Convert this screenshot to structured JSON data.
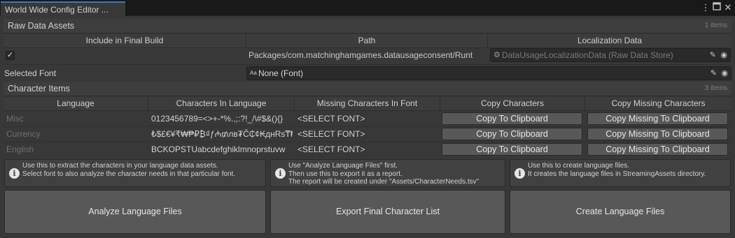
{
  "window": {
    "tab_title": "World Wide Config Editor ...",
    "menu_icon": "kebab-menu-icon",
    "maximize_icon": "maximize-icon",
    "close_icon": "close-icon"
  },
  "raw_data_assets": {
    "title": "Raw Data Assets",
    "count": "1 items",
    "columns": [
      "Include in Final Build",
      "Path",
      "Localization Data"
    ],
    "rows": [
      {
        "include": true,
        "path": "Packages/com.matchinghamgames.datausageconsent/Runt",
        "localization_data": "DataUsageLocalizationData (Raw Data Store)"
      }
    ]
  },
  "selected_font": {
    "label": "Selected Font",
    "value": "None (Font)",
    "prefix_icon": "Aa"
  },
  "character_items": {
    "title": "Character Items",
    "count": "3 items",
    "columns": [
      "Language",
      "Characters In Language",
      "Missing Characters In Font",
      "Copy  Characters",
      "Copy  Missing  Characters"
    ],
    "rows": [
      {
        "language": "Misc",
        "characters": "0123456789=<>+-*%.,;:?!_/\\#$&(){}",
        "missing": "<SELECT FONT>",
        "copy_label": "Copy To Clipboard",
        "copy_missing_label": "Copy Missing To Clipboard"
      },
      {
        "language": "Currency",
        "characters": "₺$£€¥₹₩₱₽₿₫ƒ₼₥лв₮Č₵¢₭днRs₸₦",
        "missing": "<SELECT FONT>",
        "copy_label": "Copy To Clipboard",
        "copy_missing_label": "Copy Missing To Clipboard"
      },
      {
        "language": "English",
        "characters": "BCKOPSTUabcdefghiklmnoprstuvw",
        "missing": "<SELECT FONT>",
        "copy_label": "Copy To Clipboard",
        "copy_missing_label": "Copy Missing To Clipboard"
      }
    ]
  },
  "help_boxes": [
    {
      "lines": [
        "Use this to extract the characters in your language data assets.",
        "Select font to also analyze the character needs in that particular font."
      ]
    },
    {
      "lines": [
        "Use \"Analyze Language Files\" first.",
        "Then use this to export it as a report.",
        "The report will be created under \"Assets/CharacterNeeds.tsv\""
      ]
    },
    {
      "lines": [
        "Use this to create language files.",
        "It creates the language files in StreamingAssets directory."
      ]
    }
  ],
  "actions": {
    "analyze": "Analyze Language Files",
    "export": "Export Final Character List",
    "create": "Create Language Files"
  },
  "colors": {
    "tab_accent": "#3a79bb",
    "background": "#383838",
    "button": "#585858"
  }
}
